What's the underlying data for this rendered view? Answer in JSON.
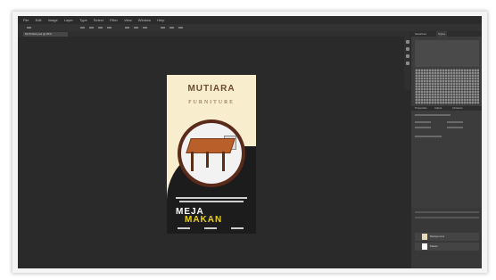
{
  "app": {
    "menu_items": [
      "File",
      "Edit",
      "Image",
      "Layer",
      "Type",
      "Select",
      "Filter",
      "View",
      "Window",
      "Help"
    ],
    "doc_tab": "MUTIARA.psd @ 25%"
  },
  "panels": {
    "tabs": [
      "Swatches",
      "Styles"
    ],
    "properties_tabs": [
      "Properties",
      "Adjust",
      "Libraries"
    ],
    "layers": [
      "Background",
      "Makan"
    ]
  },
  "poster": {
    "brand": "MUTIARA",
    "subtitle": "FURNITURE",
    "line1": "MEJA",
    "line2": "MAKAN"
  },
  "colors": {
    "poster_bg": "#f8eecd",
    "brand": "#6d4a2e",
    "accent_yellow": "#e8cf1c",
    "dark": "#1c1c1c"
  }
}
